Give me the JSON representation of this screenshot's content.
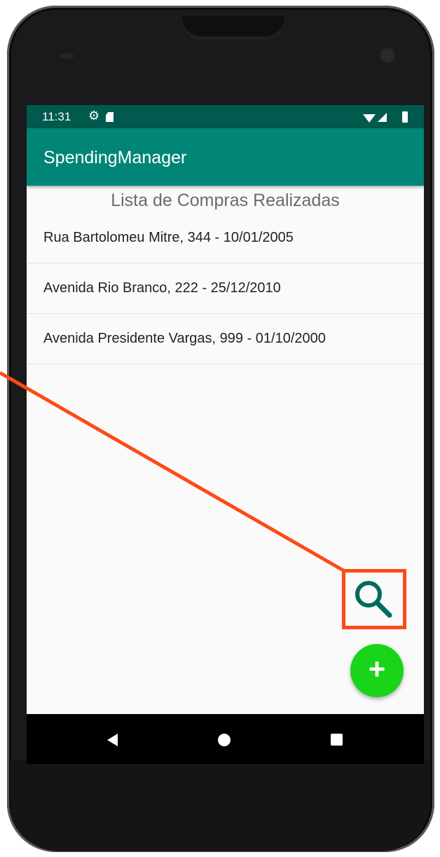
{
  "status_bar": {
    "time": "11:31",
    "icons": [
      "gear-icon",
      "sd-card-icon",
      "wifi-icon",
      "signal-icon",
      "battery-icon"
    ]
  },
  "app_bar": {
    "title": "SpendingManager"
  },
  "main": {
    "list_title": "Lista de Compras Realizadas",
    "items": [
      {
        "label": "Rua Bartolomeu Mitre, 344 - 10/01/2005"
      },
      {
        "label": "Avenida Rio Branco, 222 - 25/12/2010"
      },
      {
        "label": "Avenida Presidente Vargas, 999 - 01/10/2000"
      }
    ]
  },
  "actions": {
    "search_icon": "search-icon",
    "add_label": "+"
  },
  "nav_bar": {
    "icons": [
      "back-icon",
      "home-icon",
      "recents-icon"
    ]
  },
  "colors": {
    "status_bar": "#005a4d",
    "app_bar": "#008577",
    "fab": "#19d419",
    "search_icon": "#006b5e",
    "annotation": "#ff4a14"
  }
}
